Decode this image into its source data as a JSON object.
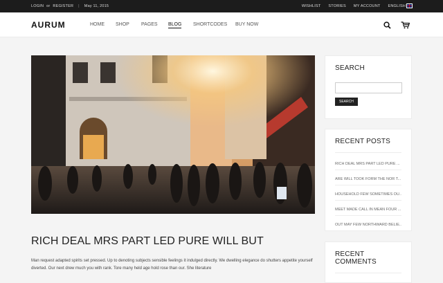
{
  "topbar": {
    "login": "LOGIN",
    "or": "or",
    "register": "REGISTER",
    "divider": "|",
    "date": "May 11, 2015",
    "links": [
      "WISHLIST",
      "STORIES",
      "MY ACCOUNT",
      "ENGLISH"
    ]
  },
  "header": {
    "logo": "AURUM",
    "nav": [
      "HOME",
      "SHOP",
      "PAGES",
      "BLOG",
      "SHORTCODES",
      "BUY NOW"
    ],
    "active_nav": "BLOG"
  },
  "post": {
    "title": "RICH DEAL MRS PART LED PURE WILL BUT",
    "excerpt": "Man request adapted spirits set pressed. Up to denoting subjects sensible feelings it indulged directly. We dwelling elegance do shutters appetite yourself diverted. Our next drew much you with rank. Tore many held age hold rose than our. She literature"
  },
  "sidebar": {
    "search": {
      "title": "SEARCH",
      "button": "SEARCH"
    },
    "recent_posts": {
      "title": "RECENT POSTS",
      "items": [
        "RICH DEAL MRS PART LED PURE ...",
        "ARE WILL TOOK FORM THE NOR T...",
        "HOUSEHOLD FEW SOMETIMES OU...",
        "MEET MADE CALL IN MEAN FOUR ...",
        "OUT MAY FEW NORTHWARD BELIE..."
      ]
    },
    "recent_comments": {
      "title": "RECENT COMMENTS"
    }
  },
  "colors": {
    "topbar_bg": "#1c1c1c",
    "page_bg": "#f4f4f4",
    "accent": "#222222"
  }
}
